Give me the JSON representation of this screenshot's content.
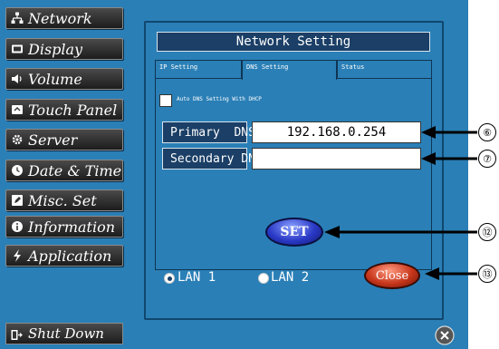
{
  "sidebar": {
    "items": [
      {
        "label": "Network",
        "icon": "network-icon"
      },
      {
        "label": "Display",
        "icon": "display-icon"
      },
      {
        "label": "Volume",
        "icon": "speaker-icon"
      },
      {
        "label": "Touch Panel",
        "icon": "touch-panel-icon"
      },
      {
        "label": "Server",
        "icon": "gear-icon"
      },
      {
        "label": "Date & Time",
        "icon": "clock-icon"
      },
      {
        "label": "Misc. Set",
        "icon": "edit-icon"
      },
      {
        "label": "Information",
        "icon": "info-icon"
      },
      {
        "label": "Application",
        "icon": "lightning-icon"
      }
    ],
    "shutdown_label": "Shut Down"
  },
  "panel": {
    "title": "Network Setting",
    "tabs": [
      "IP Setting",
      "DNS Setting",
      "Status"
    ],
    "active_tab": "DNS Setting",
    "dhcp_label": "Auto DNS Setting With DHCP",
    "dhcp_checked": false,
    "primary_label": "Primary  DNS",
    "primary_value": "192.168.0.254",
    "secondary_label": "Secondary DNS",
    "secondary_value": "",
    "set_label": "SET",
    "lan1_label": "LAN 1",
    "lan2_label": "LAN 2",
    "lan_selected": "LAN 1",
    "close_label": "Close"
  },
  "callouts": [
    "⑥",
    "⑦",
    "⑫",
    "⑬"
  ],
  "colors": {
    "screen_bg": "#2a7fb6",
    "header_bg": "#1b3f66",
    "set_button": "#2a39c6",
    "close_button": "#c7361b"
  }
}
